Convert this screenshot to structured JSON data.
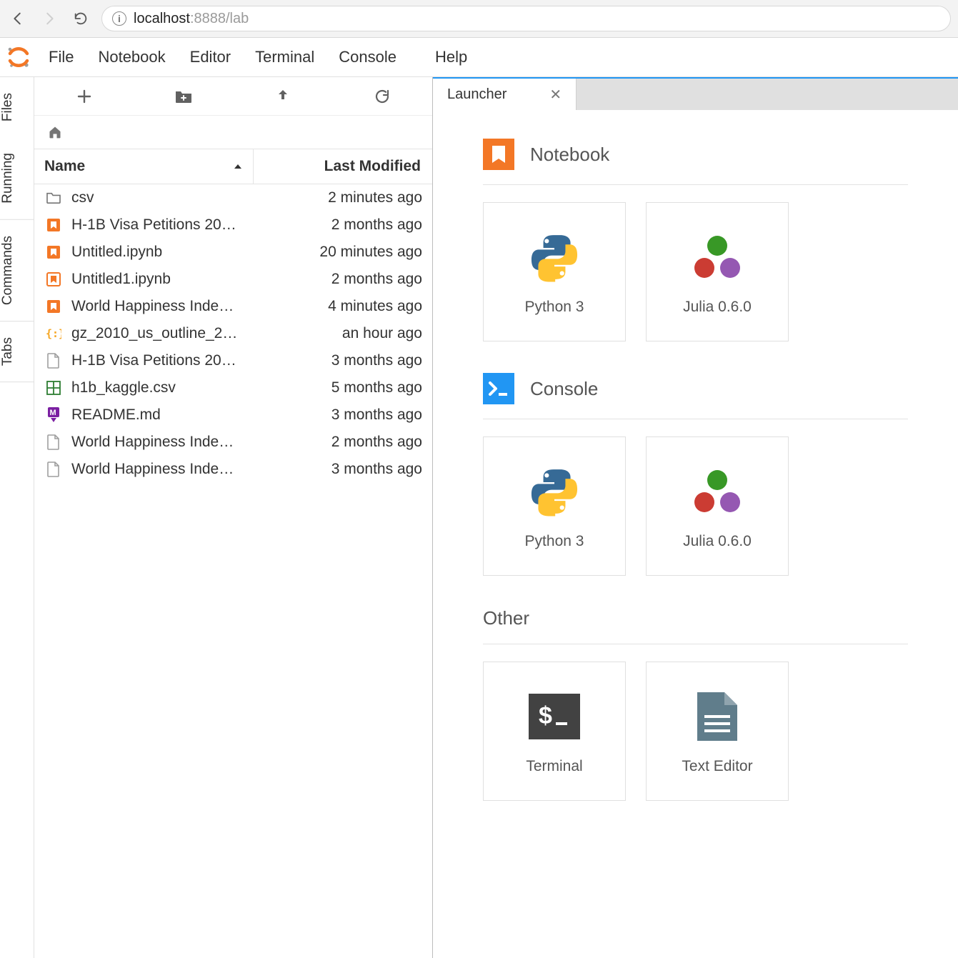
{
  "browser": {
    "url_host": "localhost",
    "url_port": ":8888",
    "url_path": "/lab"
  },
  "menu": {
    "items": [
      "File",
      "Notebook",
      "Editor",
      "Terminal",
      "Console",
      "Help"
    ]
  },
  "side_tabs": [
    "Files",
    "Running",
    "Commands",
    "Tabs"
  ],
  "file_browser": {
    "columns": {
      "name": "Name",
      "modified": "Last Modified"
    },
    "files": [
      {
        "icon": "folder",
        "name": "csv",
        "modified": "2 minutes ago"
      },
      {
        "icon": "notebook",
        "name": "H-1B Visa Petitions 20…",
        "modified": "2 months ago"
      },
      {
        "icon": "notebook",
        "name": "Untitled.ipynb",
        "modified": "20 minutes ago"
      },
      {
        "icon": "nb-run",
        "name": "Untitled1.ipynb",
        "modified": "2 months ago"
      },
      {
        "icon": "notebook",
        "name": "World Happiness Inde…",
        "modified": "4 minutes ago"
      },
      {
        "icon": "json",
        "name": "gz_2010_us_outline_2…",
        "modified": "an hour ago"
      },
      {
        "icon": "file",
        "name": "H-1B Visa Petitions 20…",
        "modified": "3 months ago"
      },
      {
        "icon": "csv",
        "name": "h1b_kaggle.csv",
        "modified": "5 months ago"
      },
      {
        "icon": "md",
        "name": "README.md",
        "modified": "3 months ago"
      },
      {
        "icon": "file",
        "name": "World Happiness Inde…",
        "modified": "2 months ago"
      },
      {
        "icon": "file",
        "name": "World Happiness Inde…",
        "modified": "3 months ago"
      }
    ]
  },
  "launcher_tab": {
    "title": "Launcher"
  },
  "launcher": {
    "sections": [
      {
        "title": "Notebook",
        "icon": "notebook",
        "cards": [
          {
            "icon": "python",
            "label": "Python 3"
          },
          {
            "icon": "julia",
            "label": "Julia 0.6.0"
          }
        ]
      },
      {
        "title": "Console",
        "icon": "console",
        "cards": [
          {
            "icon": "python",
            "label": "Python 3"
          },
          {
            "icon": "julia",
            "label": "Julia 0.6.0"
          }
        ]
      },
      {
        "title": "Other",
        "icon": "none",
        "cards": [
          {
            "icon": "terminal",
            "label": "Terminal"
          },
          {
            "icon": "texteditor",
            "label": "Text Editor"
          }
        ]
      }
    ]
  }
}
